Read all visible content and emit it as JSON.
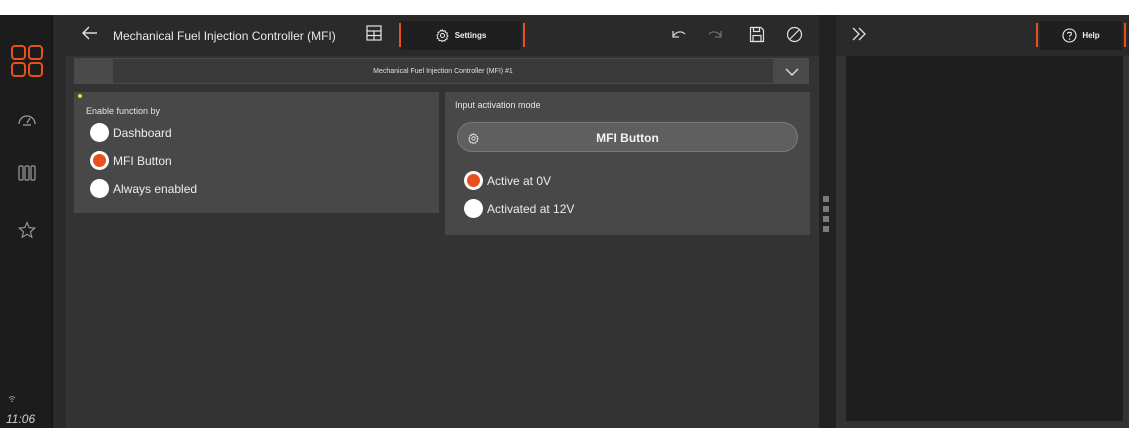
{
  "rail": {
    "clock": "11:06",
    "icons": [
      "apps-grid-icon",
      "dashboard-gauge-icon",
      "columns-icon",
      "star-icon"
    ]
  },
  "topbar": {
    "title": "Mechanical Fuel Injection Controller (MFI)",
    "settings_label": "Settings"
  },
  "selector": {
    "value": "Mechanical Fuel Injection Controller (MFI) #1"
  },
  "enable_card": {
    "label": "Enable function by",
    "options": [
      {
        "label": "Dashboard",
        "selected": false
      },
      {
        "label": "MFI Button",
        "selected": true
      },
      {
        "label": "Always enabled",
        "selected": false
      }
    ]
  },
  "activation_card": {
    "label": "Input activation mode",
    "button_label": "MFI Button",
    "options": [
      {
        "label": "Active at 0V",
        "selected": true
      },
      {
        "label": "Activated at 12V",
        "selected": false
      }
    ]
  },
  "right_panel": {
    "help_label": "Help"
  },
  "colors": {
    "accent": "#e8501c",
    "indicator": "#f2e400"
  }
}
